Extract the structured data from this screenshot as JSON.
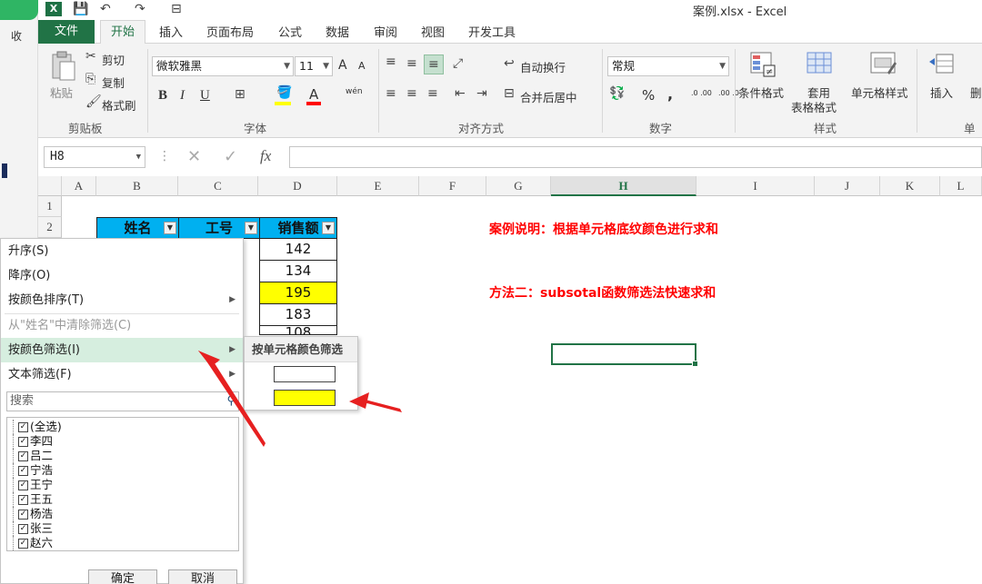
{
  "window": {
    "title": "案例.xlsx - Excel",
    "favorites_label": "收"
  },
  "qat": {
    "save": "💾",
    "undo": "↶",
    "redo": "↷",
    "customize": "⊟"
  },
  "tabs": {
    "file": "文件",
    "items": [
      "开始",
      "插入",
      "页面布局",
      "公式",
      "数据",
      "审阅",
      "视图",
      "开发工具"
    ]
  },
  "ribbon": {
    "clipboard": {
      "paste": "粘贴",
      "cut": "剪切",
      "copy": "复制",
      "format_painter": "格式刷",
      "title": "剪贴板"
    },
    "font": {
      "name": "微软雅黑",
      "size": "11",
      "bold": "B",
      "italic": "I",
      "underline": "U",
      "grow": "A",
      "shrink": "A",
      "phonetic": "wén",
      "title": "字体"
    },
    "alignment": {
      "wrap": "自动换行",
      "merge": "合并后居中",
      "title": "对齐方式"
    },
    "number": {
      "format": "常规",
      "percent": "%",
      "comma": ",",
      "inc_decimal": ".0 .00",
      "dec_decimal": ".00 .0",
      "title": "数字"
    },
    "styles": {
      "conditional": "条件格式",
      "table_line1": "套用",
      "table_line2": "表格格式",
      "cell_styles": "单元格样式",
      "title": "样式"
    },
    "cells": {
      "insert": "插入",
      "delete": "删",
      "title": "单元"
    }
  },
  "formula_bar": {
    "name_box": "H8",
    "cancel": "✕",
    "enter": "✓",
    "fx": "fx",
    "value": ""
  },
  "grid": {
    "columns": [
      "A",
      "B",
      "C",
      "D",
      "E",
      "F",
      "G",
      "H",
      "I",
      "J",
      "K",
      "L"
    ],
    "selected_column": "H",
    "rows": [
      "1",
      "2"
    ],
    "headers": [
      "姓名",
      "工号",
      "销售额"
    ],
    "sales_values": [
      "142",
      "134",
      "195",
      "183",
      "108"
    ],
    "highlight_color": "#ffff00",
    "header_color": "#00b0f0",
    "note1": "案例说明：根据单元格底纹颜色进行求和",
    "note2": "方法二：subsotal函数筛选法快速求和",
    "note_color": "#ff0000"
  },
  "filter_menu": {
    "sort_asc": "升序(S)",
    "sort_desc": "降序(O)",
    "sort_by_color": "按颜色排序(T)",
    "clear_filter": "从\"姓名\"中清除筛选(C)",
    "filter_by_color": "按颜色筛选(I)",
    "text_filter": "文本筛选(F)",
    "search_placeholder": "搜索",
    "items": [
      "(全选)",
      "李四",
      "吕二",
      "宁浩",
      "王宁",
      "王五",
      "杨浩",
      "张三",
      "赵六"
    ],
    "ok": "确定",
    "cancel": "取消"
  },
  "submenu": {
    "title": "按单元格颜色筛选",
    "colors": [
      "#ffffff",
      "#ffff00"
    ]
  }
}
